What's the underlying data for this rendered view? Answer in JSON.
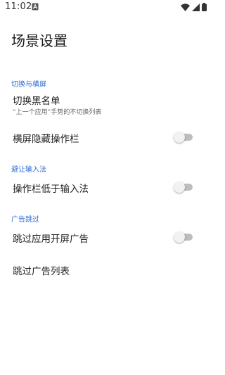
{
  "status_bar": {
    "time": "11:02",
    "icons": [
      "notification-a-icon",
      "wifi-icon",
      "cellular-signal-icon",
      "battery-icon"
    ]
  },
  "page": {
    "title": "场景设置"
  },
  "sections": [
    {
      "header": "切换与横屏",
      "items": [
        {
          "title": "切换黑名单",
          "subtitle": "“上一个应用”手势的不切换列表"
        },
        {
          "title": "横屏隐藏操作栏",
          "toggle": false
        }
      ]
    },
    {
      "header": "避让输入法",
      "items": [
        {
          "title": "操作栏低于输入法",
          "toggle": false
        }
      ]
    },
    {
      "header": "广告跳过",
      "items": [
        {
          "title": "跳过应用开屏广告",
          "toggle": false
        },
        {
          "title": "跳过广告列表"
        }
      ]
    }
  ],
  "colors": {
    "accent": "#2f6fd6",
    "toggle_track_off": "#bdbdbd",
    "toggle_thumb_off": "#f2f2f2"
  }
}
